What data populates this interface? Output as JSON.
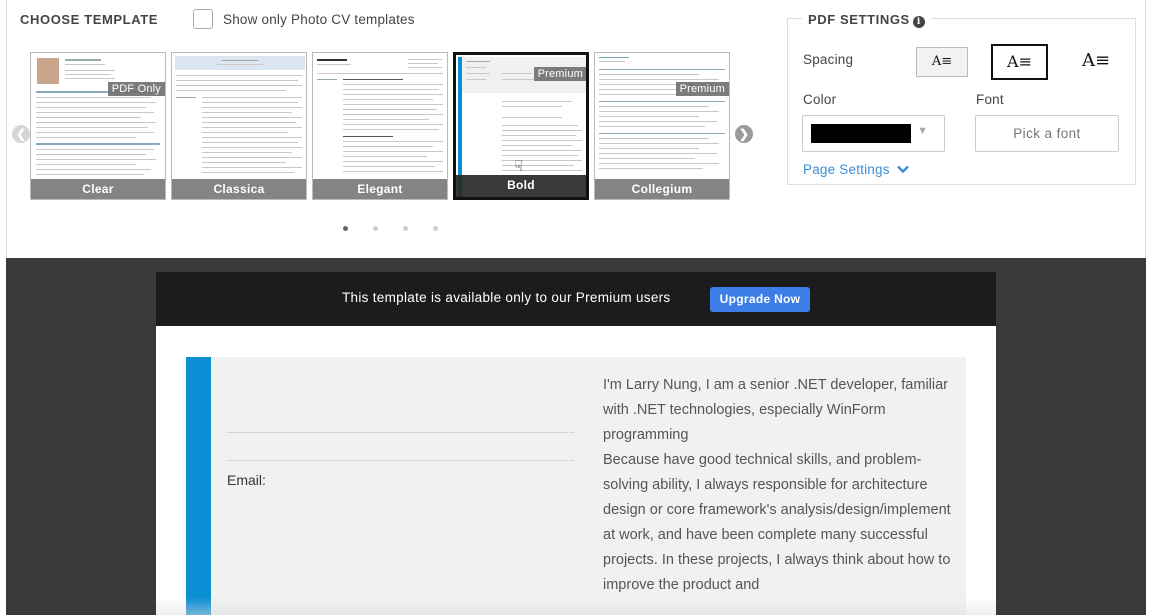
{
  "choose_template": {
    "title": "CHOOSE TEMPLATE",
    "photo_filter_label": "Show only Photo CV templates",
    "templates": [
      {
        "name": "Clear",
        "badge": "PDF Only",
        "selected": false
      },
      {
        "name": "Classica",
        "badge": "",
        "selected": false
      },
      {
        "name": "Elegant",
        "badge": "",
        "selected": false
      },
      {
        "name": "Bold",
        "badge": "Premium",
        "selected": true
      },
      {
        "name": "Collegium",
        "badge": "Premium",
        "selected": false
      }
    ],
    "page_count": 4,
    "current_page": 1
  },
  "pdf_settings": {
    "title": "PDF SETTINGS",
    "spacing_label": "Spacing",
    "spacing_options": [
      "compact",
      "normal",
      "wide"
    ],
    "spacing_selected": "normal",
    "color_label": "Color",
    "color_value": "#000000",
    "font_label": "Font",
    "font_button": "Pick a font",
    "page_settings_link": "Page Settings"
  },
  "premium_banner": {
    "text": "This template is available only to our Premium users",
    "button": "Upgrade Now"
  },
  "cv_preview": {
    "accent_color": "#0a8ed4",
    "email_label": "Email:",
    "summary": [
      "I'm Larry Nung, I am a senior .NET developer, familiar with .NET technologies, especially WinForm programming",
      "Because have good technical skills, and problem-solving ability, I always responsible for architecture design or core framework's analysis/design/implement at work, and have been complete many successful projects. In these projects, I always think about how to improve the product and"
    ]
  }
}
